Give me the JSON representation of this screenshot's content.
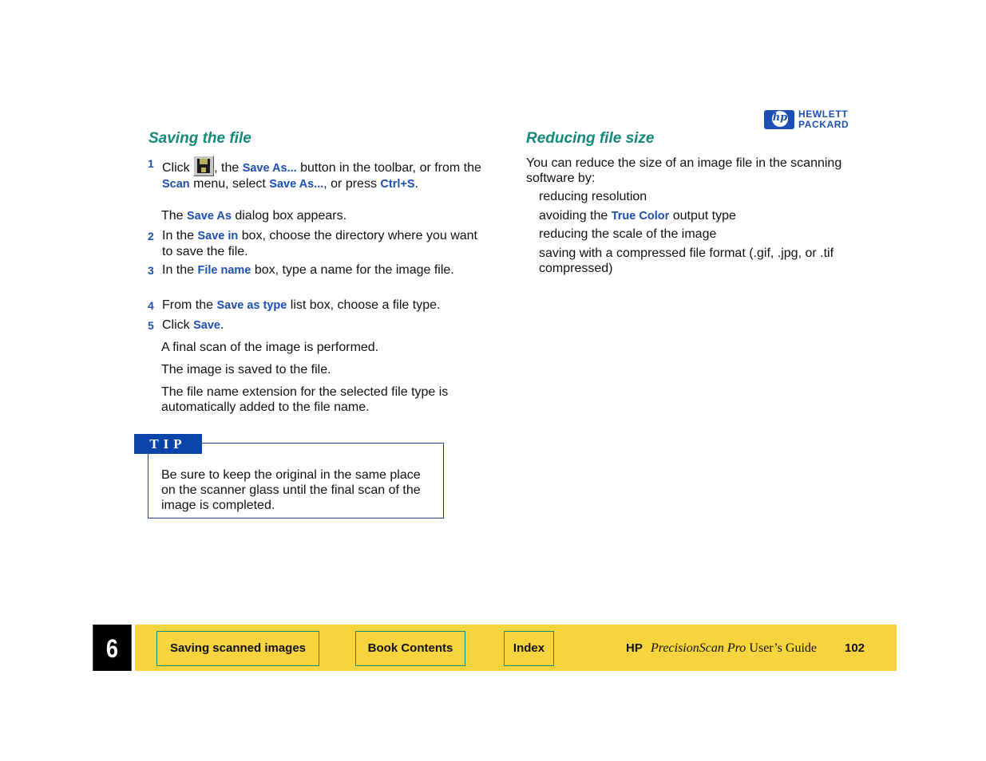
{
  "brand": {
    "logo_mark": "hp",
    "logo_line1": "HEWLETT",
    "logo_line2": "PACKARD"
  },
  "left_section": {
    "heading": "Saving the file",
    "steps": [
      {
        "number": "1",
        "parts": [
          "Click ",
          ", the ",
          "Save As...",
          " button in the toolbar, or from the ",
          "Scan",
          " menu, select ",
          "Save As...",
          ", or press ",
          "Ctrl+S",
          "."
        ],
        "icon": "save-disk-icon"
      },
      {
        "number": "2",
        "parts": [
          "In the ",
          "Save in",
          " box, choose the directory where you want to save the file."
        ]
      },
      {
        "number": "3",
        "parts": [
          "In the ",
          "File name",
          " box, type a name for the image file."
        ]
      },
      {
        "number": "4",
        "parts": [
          "From the ",
          "Save as type",
          " list box, choose a file type."
        ]
      },
      {
        "number": "5",
        "parts": [
          "Click ",
          "Save",
          "."
        ]
      }
    ],
    "after_step1": [
      "The ",
      "Save As",
      " dialog box appears."
    ],
    "results": [
      "A final scan of the image is performed.",
      "The image is saved to the file.",
      "The file name extension for the selected file type is automatically added to the file name."
    ]
  },
  "tip": {
    "label": "TIP",
    "text": "Be sure to keep the original in the same place on the scanner glass until the final scan of the image is completed."
  },
  "right_section": {
    "heading": "Reducing file size",
    "intro": "You can reduce the size of an image file in the scanning software by:",
    "bullets": [
      {
        "parts": [
          "reducing resolution"
        ]
      },
      {
        "parts": [
          "avoiding the ",
          "True Color",
          " output type"
        ]
      },
      {
        "parts": [
          "reducing the scale of the image"
        ]
      },
      {
        "parts": [
          "saving with a compressed file format (.gif, .jpg, or .tif compressed)"
        ]
      }
    ]
  },
  "footer": {
    "chapter": "6",
    "nav": {
      "section": "Saving scanned images",
      "contents": "Book Contents",
      "index": "Index"
    },
    "guide_brand": "HP",
    "guide_product": "PrecisionScan Pro",
    "guide_suffix": "User’s Guide",
    "page_number": "102"
  },
  "colors": {
    "heading": "#14897a",
    "keyword": "#1e4fb4",
    "footer_bg": "#f8d53f",
    "tip_label_bg": "#0a44aa"
  }
}
